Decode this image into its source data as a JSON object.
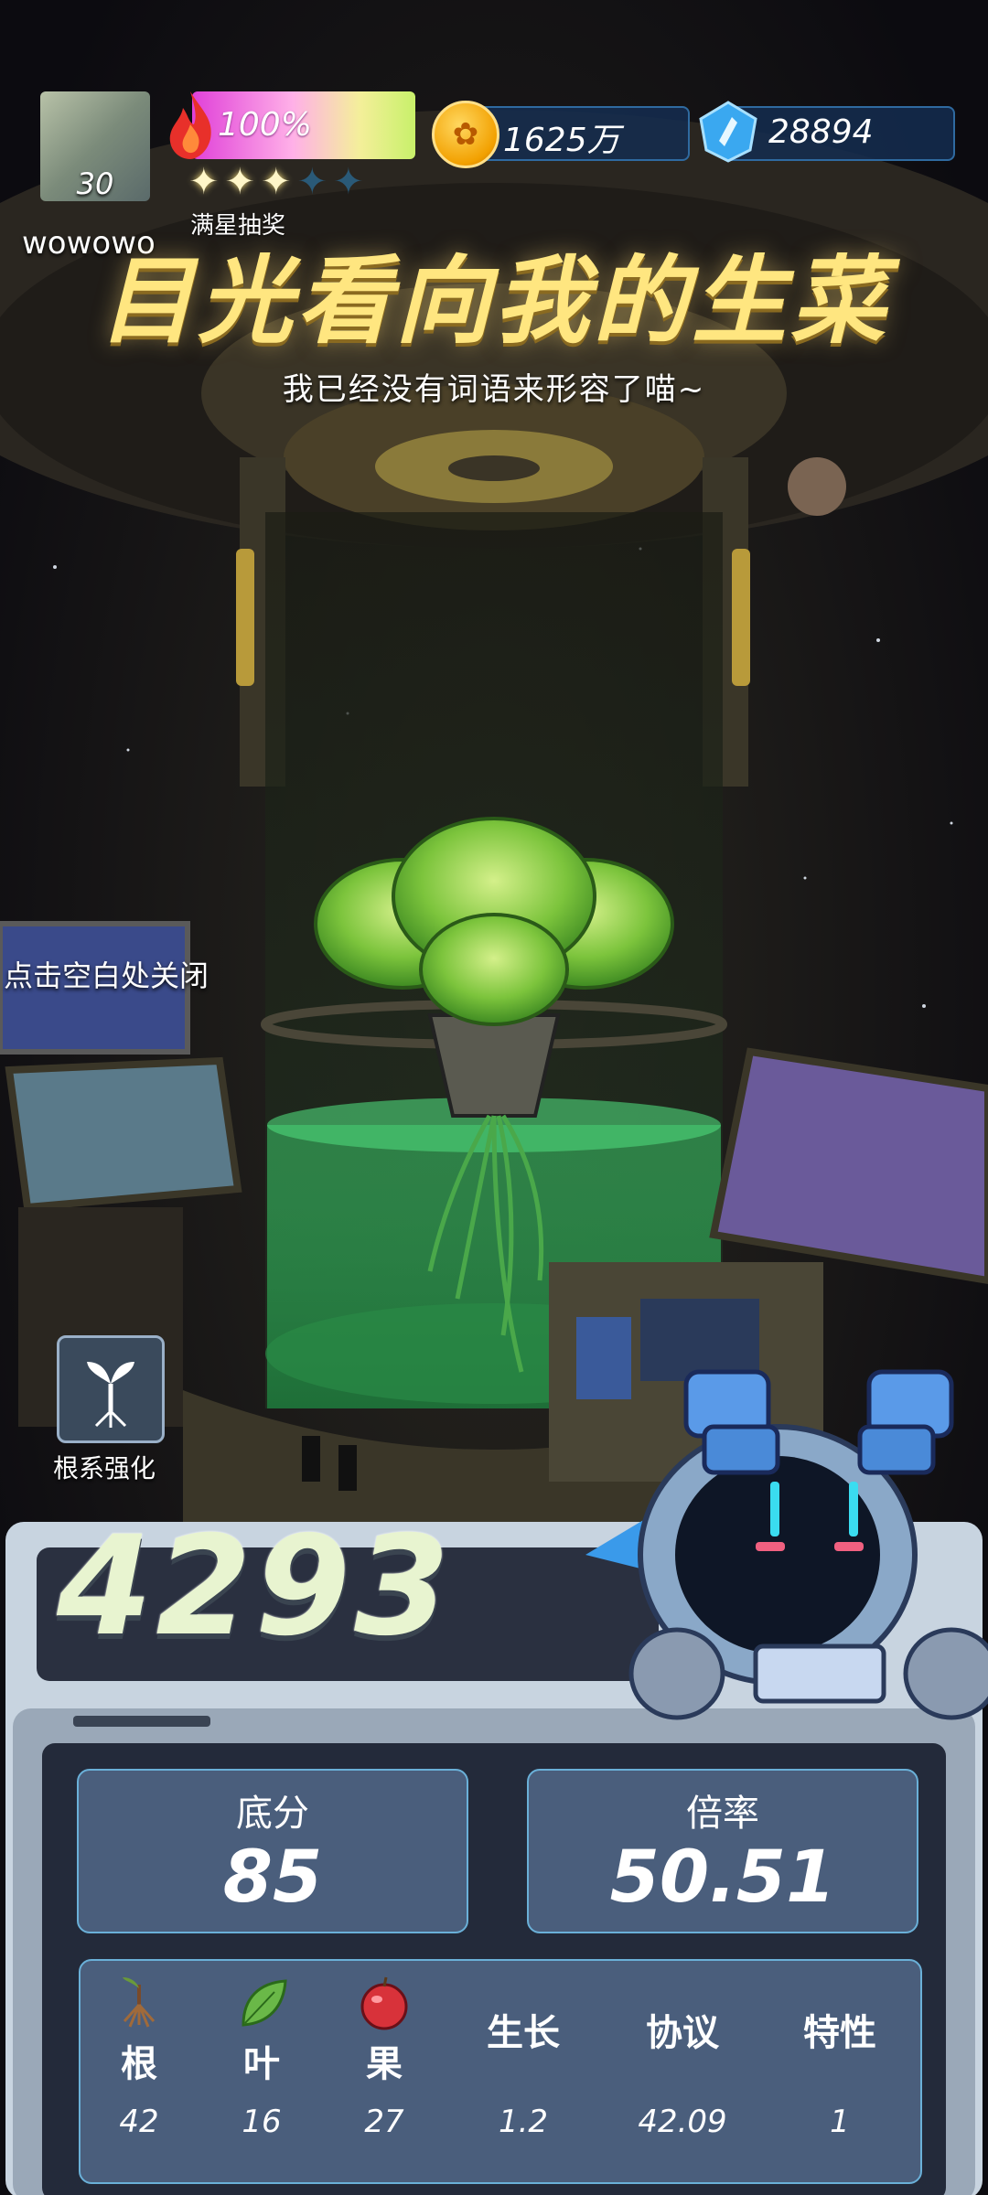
{
  "player": {
    "level": "30",
    "username": "wowowo"
  },
  "energy": {
    "percent_label": "100%",
    "stars_filled": 3,
    "stars_total": 5,
    "lottery_label": "满星抽奖"
  },
  "currency": {
    "gold": "1625万",
    "gems": "28894"
  },
  "banner": {
    "title": "目光看向我的生菜",
    "subtitle": "我已经没有词语来形容了喵~"
  },
  "hints": {
    "close": "点击空白处关闭"
  },
  "root_boost": {
    "label": "根系强化"
  },
  "score": {
    "total": "4293",
    "base_label": "底分",
    "base_value": "85",
    "multiplier_label": "倍率",
    "multiplier_value": "50.51"
  },
  "stats": [
    {
      "label": "根",
      "value": "42",
      "icon": "root-icon"
    },
    {
      "label": "叶",
      "value": "16",
      "icon": "leaf-icon"
    },
    {
      "label": "果",
      "value": "27",
      "icon": "fruit-icon"
    },
    {
      "label": "生长",
      "value": "1.2"
    },
    {
      "label": "协议",
      "value": "42.09"
    },
    {
      "label": "特性",
      "value": "1"
    }
  ],
  "colors": {
    "title": "#ffe680",
    "panel_box": "#4a5e7c",
    "panel_border": "#6ab0d8",
    "tank_glow": "#3cc86a"
  }
}
